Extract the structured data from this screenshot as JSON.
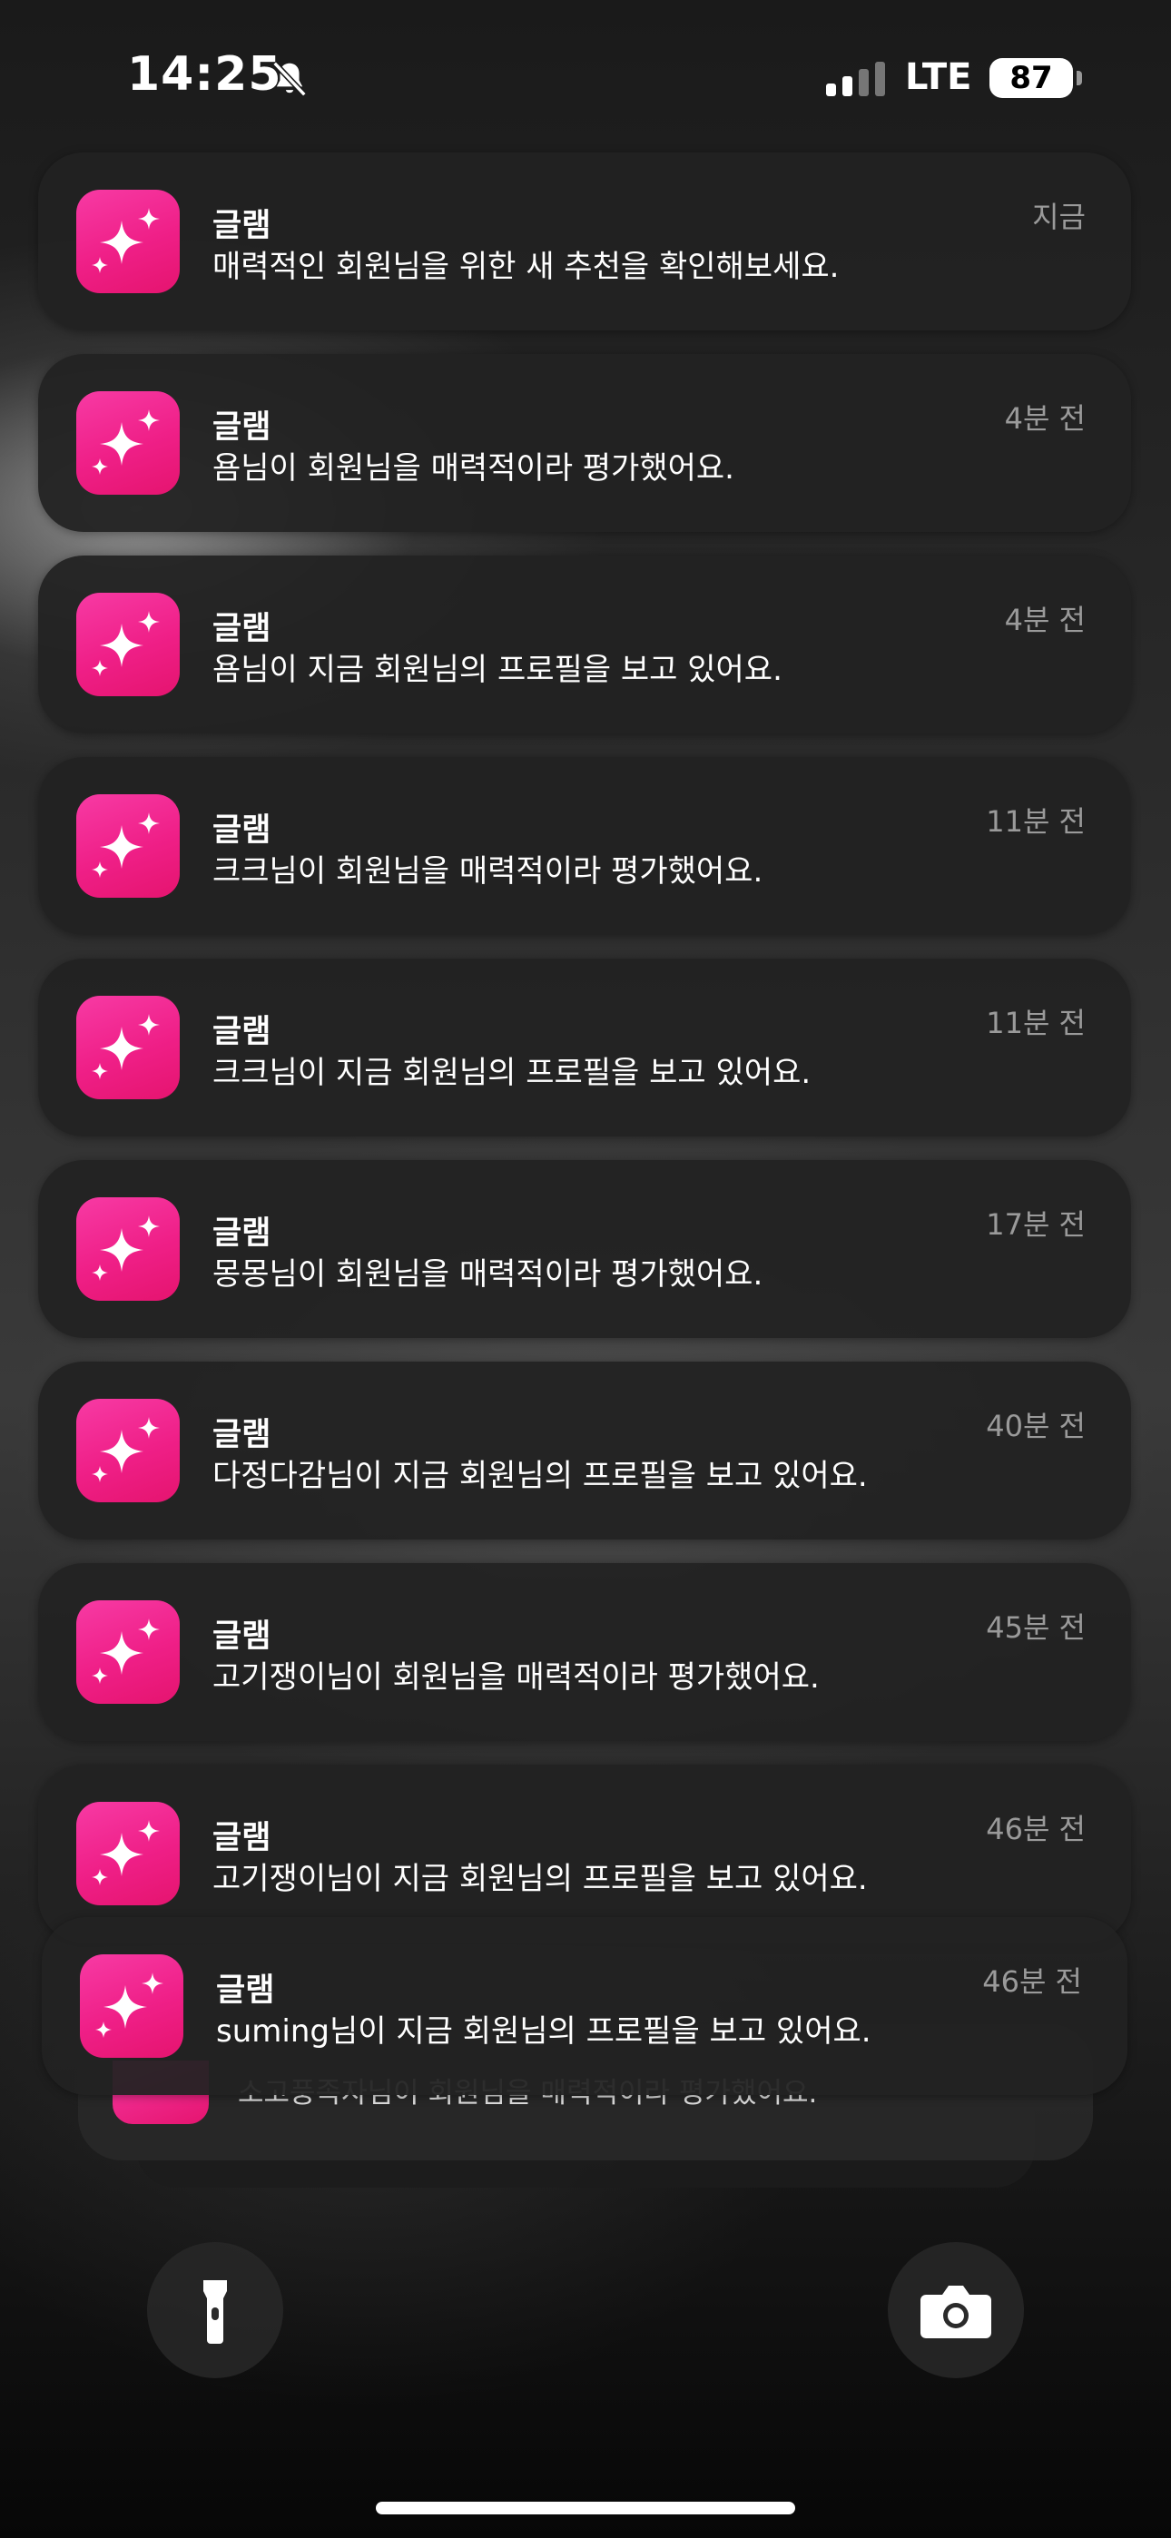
{
  "status_bar": {
    "time": "14:25",
    "network": "LTE",
    "battery": "87",
    "icons": [
      "bell-slash-icon",
      "cellular-signal-icon",
      "battery-icon"
    ]
  },
  "notifications": [
    {
      "app": "글램",
      "message": "매력적인 회원님을 위한 새 추천을 확인해보세요.",
      "time": "지금"
    },
    {
      "app": "글램",
      "message": "욤님이 회원님을 매력적이라 평가했어요.",
      "time": "4분 전"
    },
    {
      "app": "글램",
      "message": "욤님이 지금 회원님의 프로필을 보고 있어요.",
      "time": "4분 전"
    },
    {
      "app": "글램",
      "message": "크크님이 회원님을 매력적이라 평가했어요.",
      "time": "11분 전"
    },
    {
      "app": "글램",
      "message": "크크님이 지금 회원님의 프로필을 보고 있어요.",
      "time": "11분 전"
    },
    {
      "app": "글램",
      "message": "몽몽님이 회원님을 매력적이라 평가했어요.",
      "time": "17분 전"
    },
    {
      "app": "글램",
      "message": "다정다감님이 지금 회원님의 프로필을 보고 있어요.",
      "time": "40분 전"
    },
    {
      "app": "글램",
      "message": "고기쟁이님이 회원님을 매력적이라 평가했어요.",
      "time": "45분 전"
    },
    {
      "app": "글램",
      "message": "고기쟁이님이 지금 회원님의 프로필을 보고 있어요.",
      "time": "46분 전"
    },
    {
      "app": "글램",
      "message": "suming님이 지금 회원님의 프로필을 보고 있어요.",
      "time": "46분 전"
    }
  ],
  "stacked_preview": {
    "message": "소고풍족자님이 회원님을 매력적이라 평가했어요."
  },
  "colors": {
    "app_icon": "#ef1f87",
    "card_background": "#222222",
    "time_text": "#9a9a9a"
  },
  "bottom_controls": {
    "left": "flashlight-icon",
    "right": "camera-icon"
  }
}
